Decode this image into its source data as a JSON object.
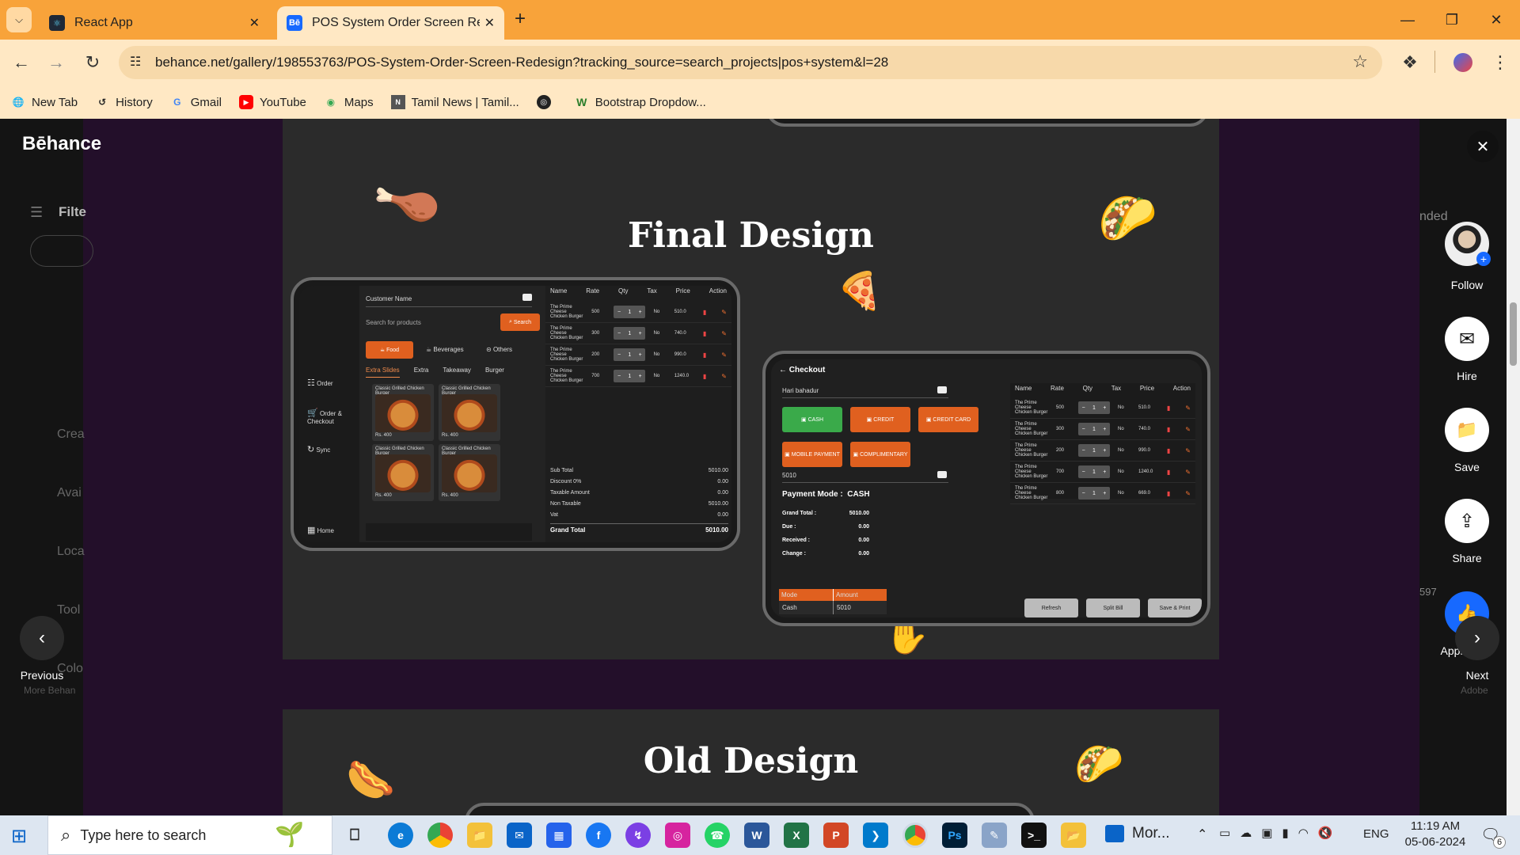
{
  "browser": {
    "tabs": [
      {
        "title": "React App",
        "favicon": "react-icon"
      },
      {
        "title": "POS System Order Screen Rede",
        "favicon": "behance-icon",
        "active": true
      }
    ],
    "url": "behance.net/gallery/198553763/POS-System-Order-Screen-Redesign?tracking_source=search_projects|pos+system&l=28",
    "bookmarks": [
      {
        "label": "New Tab",
        "icon": "globe-icon"
      },
      {
        "label": "History",
        "icon": "history-icon"
      },
      {
        "label": "Gmail",
        "icon": "google-icon"
      },
      {
        "label": "YouTube",
        "icon": "youtube-icon"
      },
      {
        "label": "Maps",
        "icon": "maps-icon"
      },
      {
        "label": "Tamil News | Tamil...",
        "icon": "news-icon"
      },
      {
        "label": "",
        "icon": "globe-icon"
      },
      {
        "label": "Bootstrap Dropdow...",
        "icon": "w-icon"
      }
    ],
    "colors": {
      "tabstrip": "#f8a33a",
      "toolbar": "#ffe8c4"
    }
  },
  "behance": {
    "logo": "Bēhance",
    "left_fragments": [
      "Filte",
      "Crea",
      "Avai",
      "Loca",
      "Tool",
      "Colo"
    ],
    "right_fragments": [
      "nded",
      "597"
    ],
    "previous_label": "Previous",
    "previous_sub": "More Behan",
    "next_label": "Next",
    "next_sub": "Adobe"
  },
  "project": {
    "final_heading": "Final Design",
    "old_heading": "Old Design"
  },
  "pos_order": {
    "customer_label": "Customer Name",
    "search_placeholder": "Search for products",
    "search_btn": "Search",
    "categories": [
      "Food",
      "Beverages",
      "Others"
    ],
    "subtabs": [
      "Extra Slides",
      "Extra",
      "Takeaway",
      "Burger"
    ],
    "nav": [
      "Order",
      "Order & Checkout",
      "Sync",
      "Home"
    ],
    "product_name": "Classic Grilled Chicken Burger",
    "product_price": "Rs. 400",
    "columns": [
      "Name",
      "Rate",
      "Qty",
      "Tax",
      "Price",
      "Action"
    ],
    "rows": [
      {
        "name": "The Prime Cheese Chicken Burger",
        "rate": "500",
        "qty": "1",
        "tax": "No",
        "price": "510.0"
      },
      {
        "name": "The Prime Cheese Chicken Burger",
        "rate": "300",
        "qty": "1",
        "tax": "No",
        "price": "740.0"
      },
      {
        "name": "The Prime Cheese Chicken Burger",
        "rate": "200",
        "qty": "1",
        "tax": "No",
        "price": "990.0"
      },
      {
        "name": "The Prime Cheese Chicken Burger",
        "rate": "700",
        "qty": "1",
        "tax": "No",
        "price": "1240.0"
      }
    ],
    "totals": [
      {
        "label": "Sub Total",
        "value": "5010.00"
      },
      {
        "label": "Discount   0%",
        "value": "0.00"
      },
      {
        "label": "Taxable Amount",
        "value": "0.00"
      },
      {
        "label": "Non Taxable",
        "value": "5010.00"
      },
      {
        "label": "Vat",
        "value": "0.00"
      }
    ],
    "grand_total_label": "Grand Total",
    "grand_total_value": "5010.00"
  },
  "pos_checkout": {
    "title": "Checkout",
    "customer": "Hari bahadur",
    "pay_methods": [
      "CASH",
      "CREDIT",
      "CREDIT CARD",
      "MOBILE PAYMENT",
      "COMPLIMENTARY"
    ],
    "amount_input": "5010",
    "payment_mode_label": "Payment Mode :",
    "payment_mode_value": "CASH",
    "summary": [
      {
        "label": "Grand Total :",
        "value": "5010.00"
      },
      {
        "label": "Due :",
        "value": "0.00"
      },
      {
        "label": "Received :",
        "value": "0.00"
      },
      {
        "label": "Change :",
        "value": "0.00"
      }
    ],
    "mode_headers": [
      "Mode",
      "Amount"
    ],
    "mode_row": [
      "Cash",
      "5010"
    ],
    "columns": [
      "Name",
      "Rate",
      "Qty",
      "Tax",
      "Price",
      "Action"
    ],
    "rows": [
      {
        "name": "The Prime Cheese Chicken Burger",
        "rate": "500",
        "qty": "1",
        "tax": "No",
        "price": "510.0"
      },
      {
        "name": "The Prime Cheese Chicken Burger",
        "rate": "300",
        "qty": "1",
        "tax": "No",
        "price": "740.0"
      },
      {
        "name": "The Prime Cheese Chicken Burger",
        "rate": "200",
        "qty": "1",
        "tax": "No",
        "price": "990.0"
      },
      {
        "name": "The Prime Cheese Chicken Burger",
        "rate": "700",
        "qty": "1",
        "tax": "No",
        "price": "1240.0"
      },
      {
        "name": "The Prime Cheese Chicken Burger",
        "rate": "800",
        "qty": "1",
        "tax": "No",
        "price": "669.0"
      }
    ],
    "buttons": [
      "Refresh",
      "Split Bill",
      "Save & Print"
    ]
  },
  "actions": [
    {
      "label": "Follow",
      "icon": "avatar-icon"
    },
    {
      "label": "Hire",
      "icon": "mail-icon"
    },
    {
      "label": "Save",
      "icon": "folder-icon"
    },
    {
      "label": "Share",
      "icon": "share-icon"
    },
    {
      "label": "Appreciate",
      "icon": "thumbs-up-icon"
    }
  ],
  "taskbar": {
    "search_placeholder": "Type here to search",
    "more_label": "Mor...",
    "language": "ENG",
    "time": "11:19 AM",
    "date": "05-06-2024",
    "notifications": "6"
  }
}
